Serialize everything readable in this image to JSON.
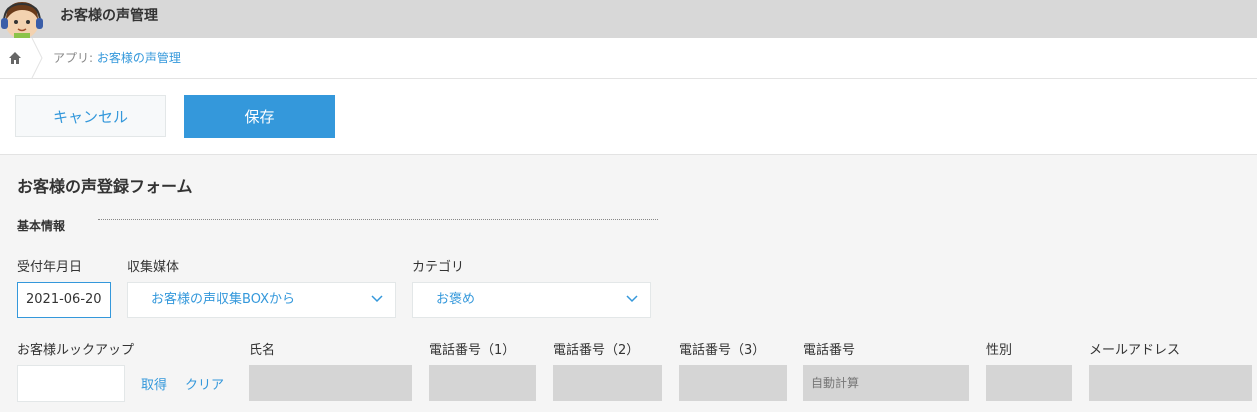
{
  "app": {
    "title": "お客様の声管理"
  },
  "breadcrumb": {
    "prefix": "アプリ: ",
    "app_link": "お客様の声管理"
  },
  "toolbar": {
    "cancel_label": "キャンセル",
    "save_label": "保存"
  },
  "form": {
    "title": "お客様の声登録フォーム",
    "section": "基本情報",
    "fields": {
      "received_date": {
        "label": "受付年月日",
        "value": "2021-06-20"
      },
      "channel": {
        "label": "収集媒体",
        "value": "お客様の声収集BOXから"
      },
      "category": {
        "label": "カテゴリ",
        "value": "お褒め"
      },
      "customer_lookup": {
        "label": "お客様ルックアップ",
        "value": "",
        "get_label": "取得",
        "clear_label": "クリア"
      },
      "name": {
        "label": "氏名",
        "value": ""
      },
      "phone1": {
        "label": "電話番号（1）",
        "value": ""
      },
      "phone2": {
        "label": "電話番号（2）",
        "value": ""
      },
      "phone3": {
        "label": "電話番号（3）",
        "value": ""
      },
      "phone": {
        "label": "電話番号",
        "value": "自動計算"
      },
      "gender": {
        "label": "性別",
        "value": ""
      },
      "email": {
        "label": "メールアドレス",
        "value": ""
      }
    }
  },
  "colors": {
    "accent": "#3498db",
    "header_bg": "#d8d8d8",
    "page_bg": "#f5f5f5",
    "readonly_bg": "#d5d5d5"
  },
  "icons": {
    "home": "home-icon",
    "chevron": "chevron-down-icon",
    "avatar": "headset-operator-avatar"
  }
}
